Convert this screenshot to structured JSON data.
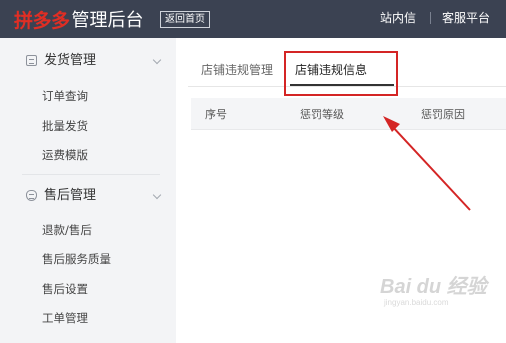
{
  "header": {
    "logo_text": "拼多多",
    "app_title": "管理后台",
    "home_button": "返回首页",
    "links": [
      "站内信",
      "客服平台"
    ]
  },
  "sidebar": {
    "groups": [
      {
        "title": "发货管理",
        "icon": "list-icon",
        "items": [
          "订单查询",
          "批量发货",
          "运费模版"
        ]
      },
      {
        "title": "售后管理",
        "icon": "shield-icon",
        "items": [
          "退款/售后",
          "售后服务质量",
          "售后设置",
          "工单管理"
        ]
      }
    ]
  },
  "main": {
    "tabs": [
      {
        "label": "店铺违规管理",
        "active": false
      },
      {
        "label": "店铺违规信息",
        "active": true
      }
    ],
    "table": {
      "columns": [
        "序号",
        "惩罚等级",
        "惩罚原因"
      ]
    }
  },
  "annotation": {
    "highlight_color": "#d42525",
    "arrow_color": "#d42525"
  },
  "watermark": {
    "brand": "Bai du 经验",
    "url": "jingyan.baidu.com"
  },
  "colors": {
    "topbar_bg": "#3b4252",
    "logo_red": "#e02e24",
    "sidebar_bg": "#f3f4f6"
  }
}
